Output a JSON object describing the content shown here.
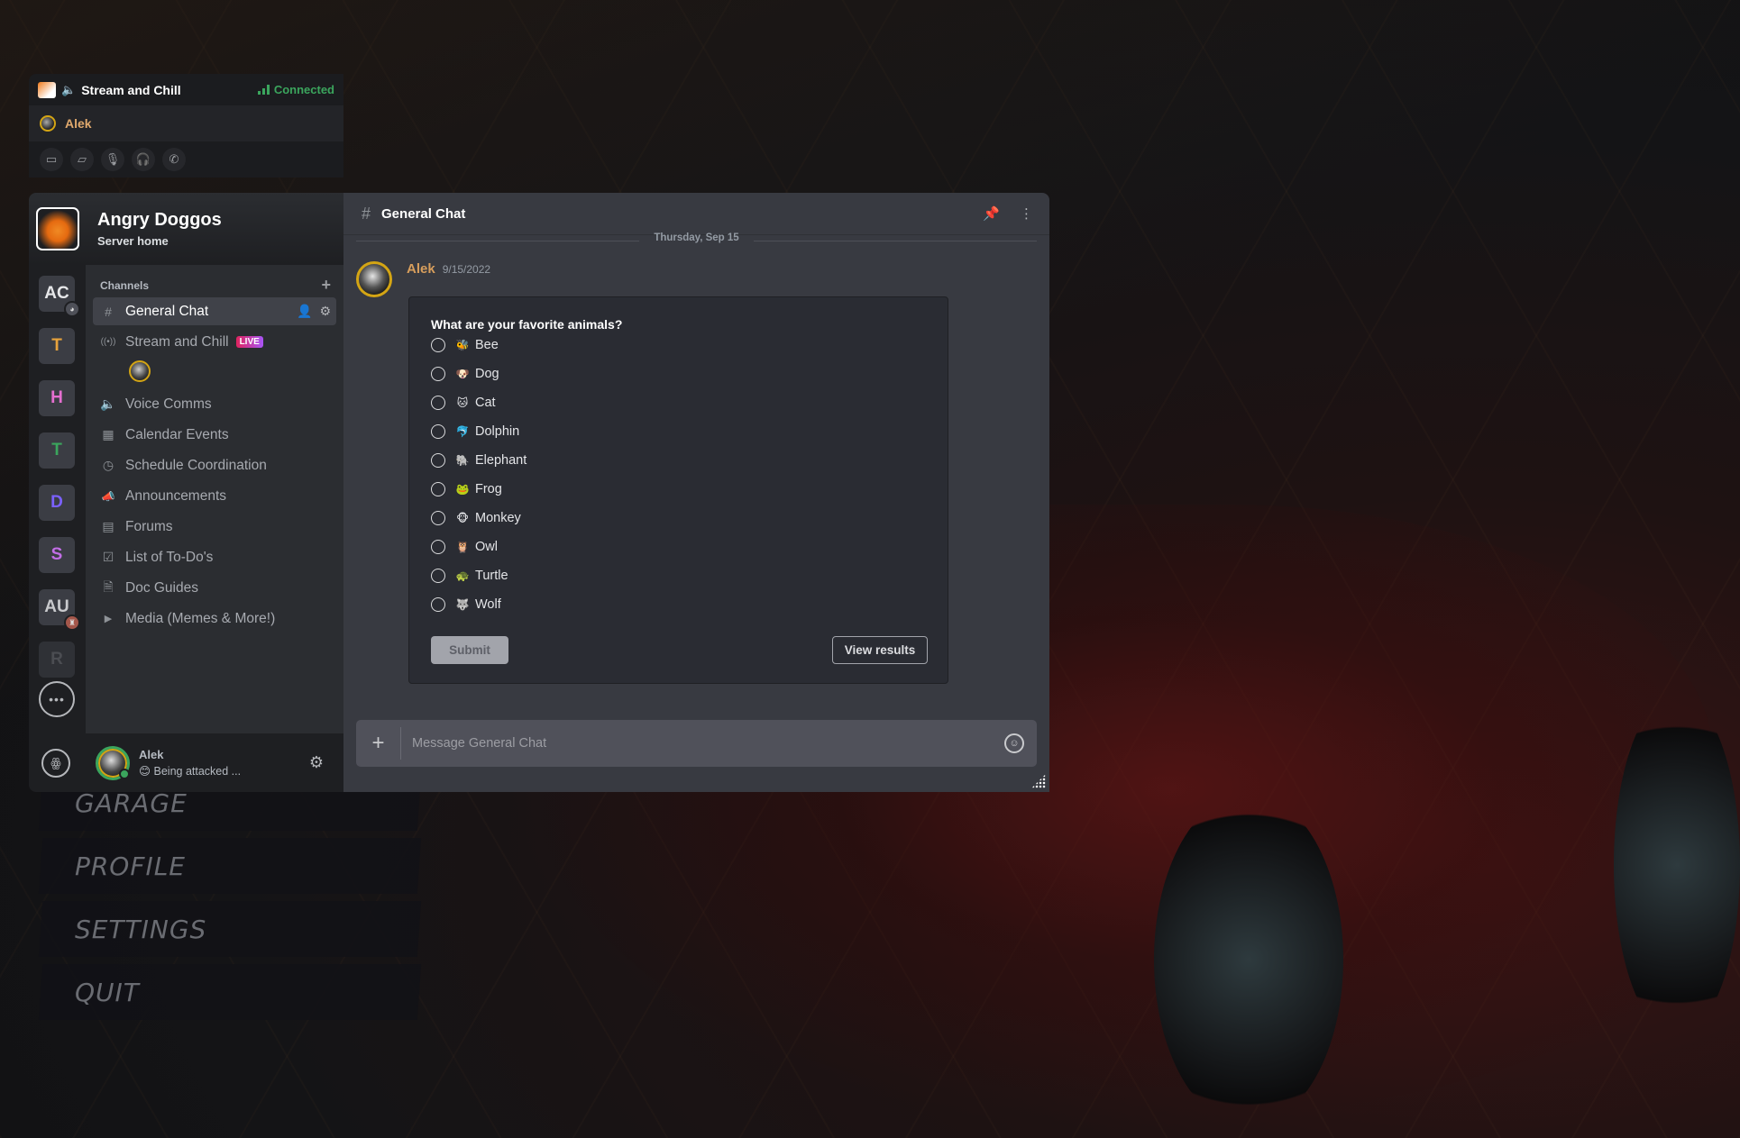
{
  "game_menu": {
    "items": [
      "GARAGE",
      "PROFILE",
      "SETTINGS",
      "QUIT"
    ]
  },
  "voice_panel": {
    "channel_name": "Stream and Chill",
    "status": "Connected",
    "user": "Alek",
    "controls": [
      "screen-share-off-icon",
      "camera-off-icon",
      "microphone-icon",
      "headphones-icon",
      "disconnect-icon"
    ]
  },
  "server": {
    "name": "Angry Doggos",
    "subtitle": "Server home"
  },
  "rail": {
    "items": [
      {
        "label": "AC",
        "color": "#e6e7e9",
        "badge": true
      },
      {
        "label": "T",
        "color": "#e8a33c"
      },
      {
        "label": "H",
        "color": "#e56fd0"
      },
      {
        "label": "T",
        "color": "#3ba55d"
      },
      {
        "label": "D",
        "color": "#7b61ff"
      },
      {
        "label": "S",
        "color": "#c26ee6"
      },
      {
        "label": "AU",
        "color": "#c9cacd",
        "badge": true
      },
      {
        "label": "R",
        "color": "#6a6c72"
      }
    ],
    "more_label": "•••"
  },
  "channels": {
    "header": "Channels",
    "items": [
      {
        "icon": "#",
        "name": "General Chat",
        "active": true
      },
      {
        "icon": "((•))",
        "name": "Stream and Chill",
        "badge": "LIVE"
      },
      {
        "icon": "🔈",
        "name": "Voice Comms"
      },
      {
        "icon": "▦",
        "name": "Calendar Events"
      },
      {
        "icon": "◷",
        "name": "Schedule Coordination"
      },
      {
        "icon": "📣",
        "name": "Announcements"
      },
      {
        "icon": "▤",
        "name": "Forums"
      },
      {
        "icon": "☑",
        "name": "List of To-Do's"
      },
      {
        "icon": "🗎",
        "name": "Doc Guides"
      },
      {
        "icon": "▶",
        "name": "Media (Memes & More!)"
      }
    ]
  },
  "user_panel": {
    "name": "Alek",
    "status_emoji": "😊",
    "status": "Being attacked ..."
  },
  "chat": {
    "channel": "General Chat",
    "date_divider": "Thursday, Sep 15",
    "message": {
      "author": "Alek",
      "timestamp": "9/15/2022"
    },
    "poll": {
      "question": "What are your favorite animals?",
      "options": [
        {
          "emoji": "🐝",
          "label": "Bee"
        },
        {
          "emoji": "🐶",
          "label": "Dog"
        },
        {
          "emoji": "🐱",
          "label": "Cat"
        },
        {
          "emoji": "🐬",
          "label": "Dolphin"
        },
        {
          "emoji": "🐘",
          "label": "Elephant"
        },
        {
          "emoji": "🐸",
          "label": "Frog"
        },
        {
          "emoji": "🐵",
          "label": "Monkey"
        },
        {
          "emoji": "🦉",
          "label": "Owl"
        },
        {
          "emoji": "🐢",
          "label": "Turtle"
        },
        {
          "emoji": "🐺",
          "label": "Wolf"
        }
      ],
      "submit_label": "Submit",
      "results_label": "View results"
    },
    "composer_placeholder": "Message General Chat"
  }
}
